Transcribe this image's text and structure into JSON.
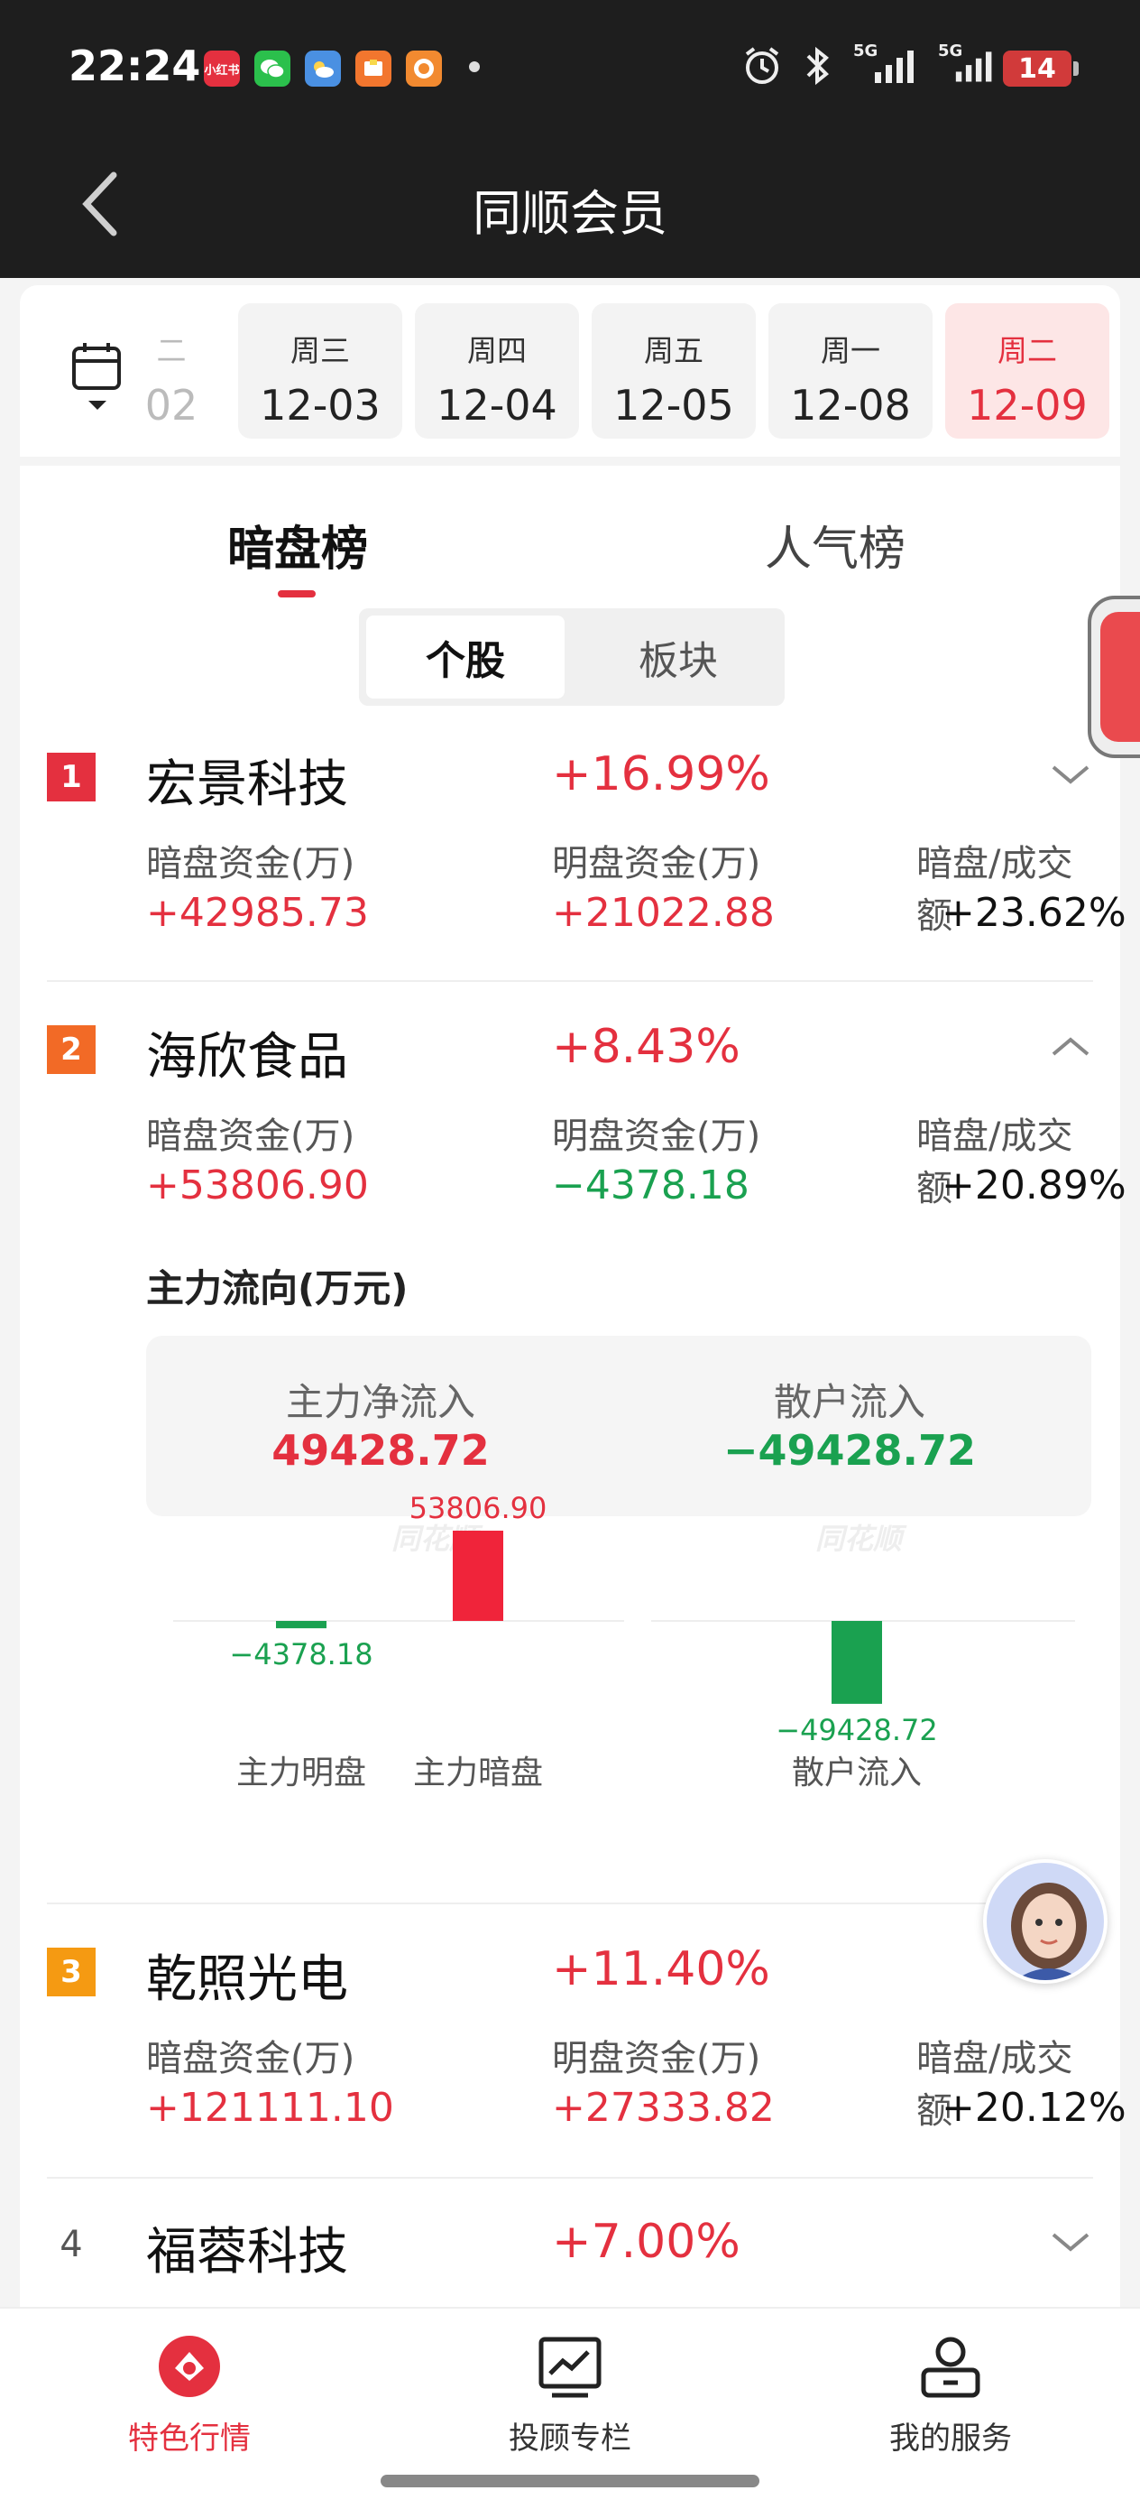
{
  "status_bar": {
    "time": "22:24",
    "app_icons": [
      {
        "name": "xiaohongshu-icon",
        "label": "小红书",
        "color": "#e4303f"
      },
      {
        "name": "wechat-icon",
        "label": "",
        "color": "#2bc04c"
      },
      {
        "name": "weather-icon",
        "label": "",
        "color": "#4a90e2"
      },
      {
        "name": "wallet-icon",
        "label": "",
        "color": "#f2762e"
      },
      {
        "name": "taobao-icon",
        "label": "",
        "color": "#f28a30"
      }
    ],
    "signal_1": "5G",
    "signal_2": "5G",
    "battery": "14"
  },
  "header": {
    "title": "同顺会员"
  },
  "date_strip": {
    "partial": {
      "weekday": "二",
      "date": "02"
    },
    "dates": [
      {
        "weekday": "周三",
        "date": "12-03"
      },
      {
        "weekday": "周四",
        "date": "12-04"
      },
      {
        "weekday": "周五",
        "date": "12-05"
      },
      {
        "weekday": "周一",
        "date": "12-08"
      },
      {
        "weekday": "周二",
        "date": "12-09"
      }
    ]
  },
  "tabs": {
    "active": "暗盘榜",
    "other": "人气榜"
  },
  "segment": {
    "active": "个股",
    "other": "板块"
  },
  "labels": {
    "dark_fund": "暗盘资金(万)",
    "open_fund": "明盘资金(万)",
    "ratio": "暗盘/成交额"
  },
  "stocks": [
    {
      "rank": "1",
      "name": "宏景科技",
      "change": "+16.99%",
      "dark": "+42985.73",
      "open": "+21022.88",
      "ratio": "+23.62%"
    },
    {
      "rank": "2",
      "name": "海欣食品",
      "change": "+8.43%",
      "dark": "+53806.90",
      "open": "−4378.18",
      "ratio": "+20.89%"
    },
    {
      "rank": "3",
      "name": "乾照光电",
      "change": "+11.40%",
      "dark": "+121111.10",
      "open": "+27333.82",
      "ratio": "+20.12%"
    },
    {
      "rank": "4",
      "name": "福蓉科技",
      "change": "+7.00%"
    }
  ],
  "flow": {
    "title": "主力流向(万元)",
    "main_net_label": "主力净流入",
    "main_net_value": "49428.72",
    "retail_label": "散户流入",
    "retail_value": "−49428.72"
  },
  "chart_data": {
    "type": "bar",
    "categories": [
      "主力明盘",
      "主力暗盘",
      "散户流入"
    ],
    "values": [
      -4378.18,
      53806.9,
      -49428.72
    ],
    "value_labels": [
      "−4378.18",
      "53806.90",
      "−49428.72"
    ],
    "watermark": "同花顺",
    "colors": {
      "positive": "#f0243a",
      "negative": "#1aa150"
    }
  },
  "bottom_nav": [
    {
      "label": "特色行情",
      "active": true
    },
    {
      "label": "投顾专栏",
      "active": false
    },
    {
      "label": "我的服务",
      "active": false
    }
  ]
}
